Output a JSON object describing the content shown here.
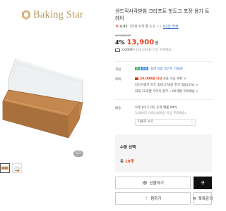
{
  "brand": {
    "name": "Baking Star"
  },
  "gallery": {
    "counter": "1/3",
    "thumbnail_count": 2
  },
  "product": {
    "title": "샌드직사각받침 크라프트 핫도그 포장 용기 트레이",
    "rating": "4.95",
    "rating_suffix": "(리뷰 6개 별 5.0 ☆)",
    "review_link": "62건 리뷰",
    "original_price": "14,500원",
    "discount": "4%",
    "price": "13,900",
    "price_unit": "원",
    "coupon_text": "3,000원",
    "coupon_sub": "(100,000원 이상 무료배송)"
  },
  "details": {
    "points_label": "적립",
    "points_badge_1": "N",
    "points_badge_2": "회원",
    "points_text": "최대 적립 포인트 706원",
    "benefit_label": "혜택",
    "benefit_line_1_amount": "20,000원 이상",
    "benefit_line_1_text": "사용 가능 쿠폰 >",
    "benefit_line_2": "라인어랜즈 카드 최대 278원 추가 적립(2%) >",
    "benefit_line_3": "최대 12개월 무이자 할부 • 60개월 무료배송 >",
    "shipping_label": "배송",
    "shipping_line_1": "오후 8:13 (목) 도착 확률 94%",
    "shipping_line_2": "3,000원 (100,000원 이상 무료배송)",
    "more_button": "자세히 보기"
  },
  "options": {
    "title": "수량 선택",
    "total_prefix": "총 ",
    "total_count": "10개",
    "total_suffix": ""
  },
  "actions": {
    "gift": "선물하기",
    "buy": "구",
    "wish": "찜하기",
    "share": "톡톡문의"
  },
  "colors": {
    "brand_gold": "#b8965c",
    "price_red": "#e2401c",
    "link_blue": "#3f6fc6"
  }
}
